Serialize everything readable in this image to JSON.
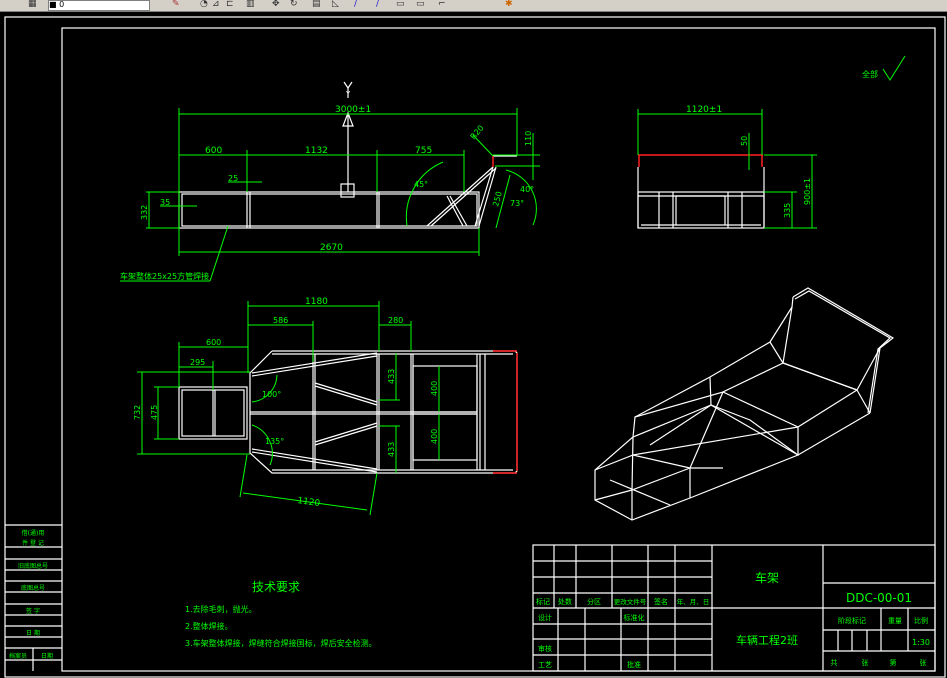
{
  "toolbar": {
    "layer_combo": "■ 0",
    "icons": [
      "match-properties-icon",
      "erase-icon",
      "mirror-icon",
      "offset-icon",
      "array-icon",
      "move-icon",
      "rotate-icon",
      "scale-icon",
      "stretch-icon",
      "trim-icon",
      "extend-icon",
      "break-icon",
      "chamfer-icon",
      "fillet-icon",
      "explode-icon"
    ]
  },
  "drawing": {
    "surface_finish": "全部",
    "side_view": {
      "overall": "3000±1",
      "seg1": "600",
      "seg2": "1132",
      "seg3": "755",
      "tube_a": "25",
      "tube_b": "35",
      "height": "332",
      "length": "2670",
      "angle1": "45°",
      "angle2": "40°",
      "angle3": "73°",
      "rise": "110",
      "r": "R20",
      "diag": "250",
      "axis_label": "Y",
      "note": "车架整体25x25方管焊接"
    },
    "end_view": {
      "width": "1120±1",
      "top": "50",
      "height_total": "900±1",
      "height_low": "335"
    },
    "plan_view": {
      "d1180": "1180",
      "d586": "586",
      "d280": "280",
      "d600": "600",
      "d295": "295",
      "d732": "732",
      "d475": "475",
      "d433a": "433",
      "d400a": "400",
      "d400b": "400",
      "d433b": "433",
      "d1120": "1120",
      "a100": "100°",
      "a135": "135°"
    }
  },
  "tech": {
    "title": "技术要求",
    "items": [
      "1.去除毛刺，抛光。",
      "2.整体焊接。",
      "3.车架整体焊接，焊缝符合焊接国标，焊后安全检测。"
    ]
  },
  "stamp": {
    "row1a": "借(通)用",
    "row1b": "件 登 记",
    "row2": "旧底图总号",
    "row3": "底图总号",
    "row4": "签 字",
    "row5": "日 期",
    "row6a": "档案员",
    "row6b": "日期"
  },
  "title_block": {
    "h": [
      "标记",
      "处数",
      "分区",
      "更改文件号",
      "签名",
      "年、月、日"
    ],
    "design": "设计",
    "standard": "标准化",
    "review": "审核",
    "process": "工艺",
    "approve": "批准",
    "part_name": "车架",
    "drawing_no": "DDC-00-01",
    "org": "车辆工程2班",
    "stage": "阶段标记",
    "weight": "重量",
    "scale_label": "比例",
    "scale": "1:30",
    "total": "共",
    "sheets1": "张",
    "page": "第",
    "sheets2": "张"
  }
}
